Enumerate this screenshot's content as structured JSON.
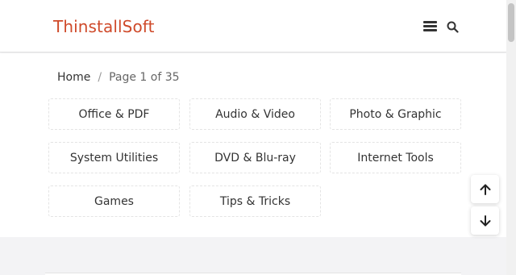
{
  "header": {
    "site_title": "ThinstallSoft",
    "brand_color": "#cf4a2a",
    "menu_icon": "hamburger-icon",
    "search_icon": "search-icon"
  },
  "breadcrumb": {
    "home": "Home",
    "separator": "/",
    "current": "Page 1 of 35"
  },
  "categories": [
    "Office & PDF",
    "Audio & Video",
    "Photo & Graphic",
    "System Utilities",
    "DVD & Blu-ray",
    "Internet Tools",
    "Games",
    "Tips & Tricks"
  ],
  "scroll_buttons": {
    "up_icon": "arrow-up-icon",
    "down_icon": "arrow-down-icon"
  }
}
